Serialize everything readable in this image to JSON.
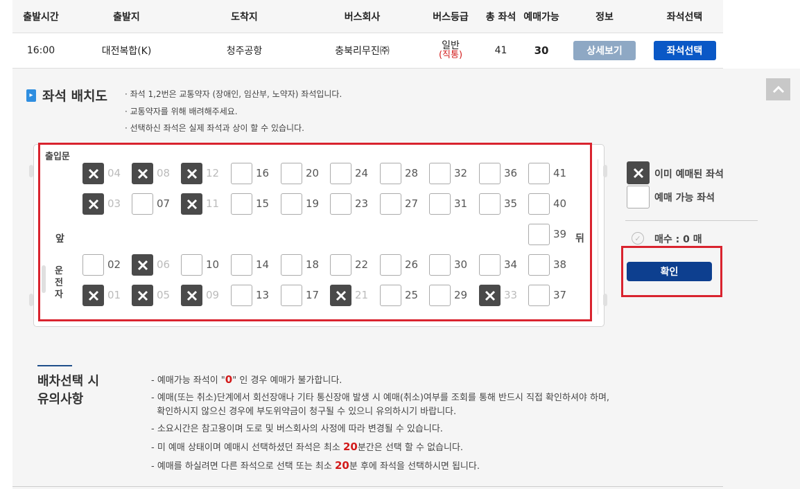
{
  "table": {
    "headers": [
      "출발시간",
      "출발지",
      "도착지",
      "버스회사",
      "버스등급",
      "총 좌석",
      "예매가능",
      "정보",
      "좌석선택"
    ],
    "row": {
      "time": "16:00",
      "from": "대전복합(K)",
      "to": "청주공항",
      "company": "충북리무진㈜",
      "grade": "일반",
      "grade_sub": "(직통)",
      "total_seats": "41",
      "available": "30",
      "detail_button": "상세보기",
      "select_button": "좌석선택"
    }
  },
  "seat_section": {
    "title": "좌석 배치도",
    "notes": [
      "· 좌석 1,2번은 교통약자 (장애인, 임산부, 노약자) 좌석입니다.",
      "· 교통약자를 위해 배려해주세요.",
      "· 선택하신 좌석은 실제 좌석과 상이 할 수 있습니다."
    ],
    "labels": {
      "door": "출입문",
      "front": "앞",
      "back": "뒤",
      "driver": [
        "운",
        "전",
        "자"
      ]
    },
    "seats": [
      {
        "no": "04",
        "taken": true
      },
      {
        "no": "08",
        "taken": true
      },
      {
        "no": "12",
        "taken": true
      },
      {
        "no": "16",
        "taken": false
      },
      {
        "no": "20",
        "taken": false
      },
      {
        "no": "24",
        "taken": false
      },
      {
        "no": "28",
        "taken": false
      },
      {
        "no": "32",
        "taken": false
      },
      {
        "no": "36",
        "taken": false
      },
      {
        "no": "41",
        "taken": false
      },
      {
        "no": "03",
        "taken": true
      },
      {
        "no": "07",
        "taken": false
      },
      {
        "no": "11",
        "taken": true
      },
      {
        "no": "15",
        "taken": false
      },
      {
        "no": "19",
        "taken": false
      },
      {
        "no": "23",
        "taken": false
      },
      {
        "no": "27",
        "taken": false
      },
      {
        "no": "31",
        "taken": false
      },
      {
        "no": "35",
        "taken": false
      },
      {
        "no": "40",
        "taken": false
      },
      {
        "no": "39",
        "taken": false
      },
      {
        "no": "02",
        "taken": false
      },
      {
        "no": "06",
        "taken": true
      },
      {
        "no": "10",
        "taken": false
      },
      {
        "no": "14",
        "taken": false
      },
      {
        "no": "18",
        "taken": false
      },
      {
        "no": "22",
        "taken": false
      },
      {
        "no": "26",
        "taken": false
      },
      {
        "no": "30",
        "taken": false
      },
      {
        "no": "34",
        "taken": false
      },
      {
        "no": "38",
        "taken": false
      },
      {
        "no": "01",
        "taken": true
      },
      {
        "no": "05",
        "taken": true
      },
      {
        "no": "09",
        "taken": true
      },
      {
        "no": "13",
        "taken": false
      },
      {
        "no": "17",
        "taken": false
      },
      {
        "no": "21",
        "taken": true
      },
      {
        "no": "25",
        "taken": false
      },
      {
        "no": "29",
        "taken": false
      },
      {
        "no": "33",
        "taken": true
      },
      {
        "no": "37",
        "taken": false
      }
    ]
  },
  "legend": {
    "taken_label": "이미 예매된 좌석",
    "available_label": "예매 가능 좌석",
    "count_text": "매수 : 0 매",
    "confirm_button": "확인"
  },
  "caution": {
    "title_line1": "배차선택 시",
    "title_line2": "유의사항",
    "items": [
      {
        "pre": "- 예매가능 좌석이 \"",
        "hl": "0",
        "post": "\" 인 경우 예매가 불가합니다."
      },
      {
        "pre": "- 예매(또는 취소)단계에서 회선장애나 기타 통신장애 발생 시 예매(취소)여부를 조회를 통해 반드시 직접 확인하셔야 하며,",
        "hl": "",
        "post": ""
      },
      {
        "pre": "  확인하시지 않으신 경우에 부도위약금이 청구될 수 있으니 유의하시기 바랍니다.",
        "hl": "",
        "post": ""
      },
      {
        "pre": "- 소요시간은 참고용이며 도로 및 버스회사의 사정에 따라 변경될 수 있습니다.",
        "hl": "",
        "post": ""
      },
      {
        "pre": "- 미 예매 상태이며 예매시 선택하셨던 좌석은 최소 ",
        "hl": "20",
        "post": "분간은 선택 할 수 없습니다."
      },
      {
        "pre": "- 예매를 하실려면 다른 좌석으로 선택 또는 최소 ",
        "hl": "20",
        "post": "분 후에 좌석을 선택하시면 됩니다."
      }
    ]
  }
}
